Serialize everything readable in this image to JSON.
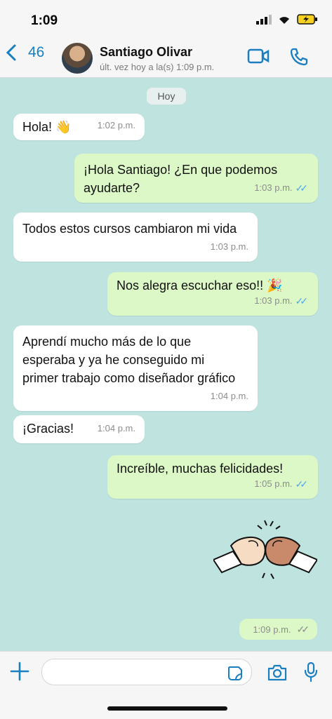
{
  "status_bar": {
    "time": "1:09"
  },
  "header": {
    "back_count": "46",
    "contact_name": "Santiago Olivar",
    "last_seen": "últ. vez hoy a la(s) 1:09 p.m."
  },
  "chat": {
    "day_label": "Hoy",
    "messages": [
      {
        "from": "contact",
        "text": "Hola! 👋",
        "time": "1:02 p.m."
      },
      {
        "from": "me",
        "text": "¡Hola Santiago! ¿En que podemos ayudarte?",
        "time": "1:03 p.m."
      },
      {
        "from": "contact",
        "text": "Todos estos cursos cambiaron mi vida",
        "time": "1:03 p.m."
      },
      {
        "from": "me",
        "text": "Nos alegra escuchar eso!! 🎉",
        "time": "1:03 p.m."
      },
      {
        "from": "contact",
        "text": "Aprendí mucho más de lo que esperaba y ya he conseguido mi primer trabajo como diseñador gráfico",
        "time": "1:04 p.m."
      },
      {
        "from": "contact",
        "text": "¡Gracias!",
        "time": "1:04 p.m."
      },
      {
        "from": "me",
        "text": "Increíble, muchas felicidades!",
        "time": "1:05 p.m."
      }
    ],
    "sticker_time": "1:09 p.m."
  },
  "colors": {
    "accent": "#1a7fc1",
    "outgoing_bubble": "#dcf8c6",
    "incoming_bubble": "#ffffff",
    "chat_background": "#bfe3df",
    "read_tick": "#4fa8f0"
  },
  "icons": [
    "back-chevron-icon",
    "video-call-icon",
    "phone-icon",
    "plus-icon",
    "sticker-icon",
    "camera-icon",
    "microphone-icon"
  ]
}
